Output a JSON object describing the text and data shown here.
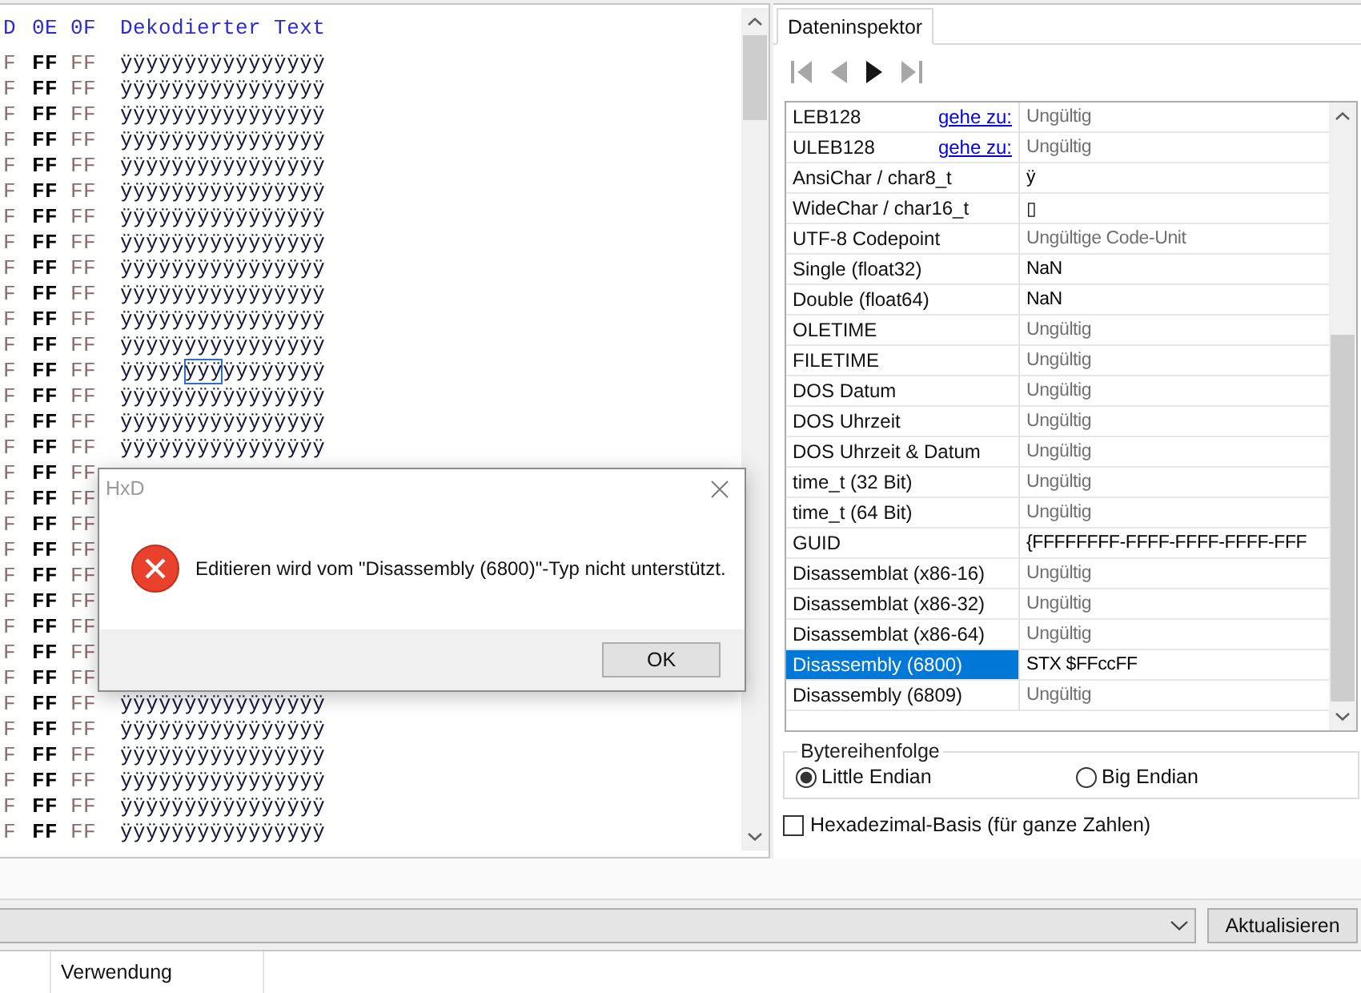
{
  "hex_view": {
    "column_headers": [
      "D",
      "0E",
      "0F"
    ],
    "text_header": "Dekodierter Text",
    "rows": [
      {
        "bytes": [
          "F",
          "FF",
          "FF"
        ],
        "text": "ÿÿÿÿÿÿÿÿÿÿÿÿÿÿÿÿ"
      },
      {
        "bytes": [
          "F",
          "FF",
          "FF"
        ],
        "text": "ÿÿÿÿÿÿÿÿÿÿÿÿÿÿÿÿ"
      },
      {
        "bytes": [
          "F",
          "FF",
          "FF"
        ],
        "text": "ÿÿÿÿÿÿÿÿÿÿÿÿÿÿÿÿ"
      },
      {
        "bytes": [
          "F",
          "FF",
          "FF"
        ],
        "text": "ÿÿÿÿÿÿÿÿÿÿÿÿÿÿÿÿ"
      },
      {
        "bytes": [
          "F",
          "FF",
          "FF"
        ],
        "text": "ÿÿÿÿÿÿÿÿÿÿÿÿÿÿÿÿ"
      },
      {
        "bytes": [
          "F",
          "FF",
          "FF"
        ],
        "text": "ÿÿÿÿÿÿÿÿÿÿÿÿÿÿÿÿ"
      },
      {
        "bytes": [
          "F",
          "FF",
          "FF"
        ],
        "text": "ÿÿÿÿÿÿÿÿÿÿÿÿÿÿÿÿ"
      },
      {
        "bytes": [
          "F",
          "FF",
          "FF"
        ],
        "text": "ÿÿÿÿÿÿÿÿÿÿÿÿÿÿÿÿ"
      },
      {
        "bytes": [
          "F",
          "FF",
          "FF"
        ],
        "text": "ÿÿÿÿÿÿÿÿÿÿÿÿÿÿÿÿ"
      },
      {
        "bytes": [
          "F",
          "FF",
          "FF"
        ],
        "text": "ÿÿÿÿÿÿÿÿÿÿÿÿÿÿÿÿ"
      },
      {
        "bytes": [
          "F",
          "FF",
          "FF"
        ],
        "text": "ÿÿÿÿÿÿÿÿÿÿÿÿÿÿÿÿ"
      },
      {
        "bytes": [
          "F",
          "FF",
          "FF"
        ],
        "text": "ÿÿÿÿÿÿÿÿÿÿÿÿÿÿÿÿ"
      },
      {
        "bytes": [
          "F",
          "FF",
          "FF"
        ],
        "segments": [
          {
            "text": "ÿÿÿÿÿ",
            "selected": false
          },
          {
            "text": "ÿÿÿ",
            "selected": true
          },
          {
            "text": "ÿÿÿÿÿÿÿÿ",
            "selected": false
          }
        ]
      },
      {
        "bytes": [
          "F",
          "FF",
          "FF"
        ],
        "text": "ÿÿÿÿÿÿÿÿÿÿÿÿÿÿÿÿ"
      },
      {
        "bytes": [
          "F",
          "FF",
          "FF"
        ],
        "text": "ÿÿÿÿÿÿÿÿÿÿÿÿÿÿÿÿ"
      },
      {
        "bytes": [
          "F",
          "FF",
          "FF"
        ],
        "text": "ÿÿÿÿÿÿÿÿÿÿÿÿÿÿÿÿ"
      },
      {
        "bytes": [
          "F",
          "FF",
          "FF"
        ]
      },
      {
        "bytes": [
          "F",
          "FF",
          "FF"
        ]
      },
      {
        "bytes": [
          "F",
          "FF",
          "FF"
        ]
      },
      {
        "bytes": [
          "F",
          "FF",
          "FF"
        ]
      },
      {
        "bytes": [
          "F",
          "FF",
          "FF"
        ]
      },
      {
        "bytes": [
          "F",
          "FF",
          "FF"
        ]
      },
      {
        "bytes": [
          "F",
          "FF",
          "FF"
        ]
      },
      {
        "bytes": [
          "F",
          "FF",
          "FF"
        ]
      },
      {
        "bytes": [
          "F",
          "FF",
          "FF"
        ]
      },
      {
        "bytes": [
          "F",
          "FF",
          "FF"
        ],
        "text": "ÿÿÿÿÿÿÿÿÿÿÿÿÿÿÿÿ"
      },
      {
        "bytes": [
          "F",
          "FF",
          "FF"
        ],
        "text": "ÿÿÿÿÿÿÿÿÿÿÿÿÿÿÿÿ"
      },
      {
        "bytes": [
          "F",
          "FF",
          "FF"
        ],
        "text": "ÿÿÿÿÿÿÿÿÿÿÿÿÿÿÿÿ"
      },
      {
        "bytes": [
          "F",
          "FF",
          "FF"
        ],
        "text": "ÿÿÿÿÿÿÿÿÿÿÿÿÿÿÿÿ"
      },
      {
        "bytes": [
          "F",
          "FF",
          "FF"
        ],
        "text": "ÿÿÿÿÿÿÿÿÿÿÿÿÿÿÿÿ"
      },
      {
        "bytes": [
          "F",
          "FF",
          "FF"
        ],
        "text": "ÿÿÿÿÿÿÿÿÿÿÿÿÿÿÿÿ"
      }
    ]
  },
  "inspector": {
    "tab": {
      "label": "Dateninspektor",
      "selected": true
    },
    "navigation": [
      {
        "kind": "first",
        "disabled": true
      },
      {
        "kind": "previous",
        "disabled": true
      },
      {
        "kind": "next",
        "disabled": false
      },
      {
        "kind": "last",
        "disabled": true
      }
    ],
    "rows": [
      {
        "label": "LEB128",
        "link": "gehe zu:",
        "value": "Ungültig",
        "valid": false,
        "selected": false
      },
      {
        "label": "ULEB128",
        "link": "gehe zu:",
        "value": "Ungültig",
        "valid": false,
        "selected": false
      },
      {
        "label": "AnsiChar / char8_t",
        "value": "ÿ",
        "valid": true,
        "selected": false
      },
      {
        "label": "WideChar / char16_t",
        "value": "▯",
        "valid": true,
        "selected": false
      },
      {
        "label": "UTF-8 Codepoint",
        "value": "Ungültige Code-Unit",
        "valid": false,
        "selected": false
      },
      {
        "label": "Single (float32)",
        "value": "NaN",
        "valid": true,
        "selected": false
      },
      {
        "label": "Double (float64)",
        "value": "NaN",
        "valid": true,
        "selected": false
      },
      {
        "label": "OLETIME",
        "value": "Ungültig",
        "valid": false,
        "selected": false
      },
      {
        "label": "FILETIME",
        "value": "Ungültig",
        "valid": false,
        "selected": false
      },
      {
        "label": "DOS Datum",
        "value": "Ungültig",
        "valid": false,
        "selected": false
      },
      {
        "label": "DOS Uhrzeit",
        "value": "Ungültig",
        "valid": false,
        "selected": false
      },
      {
        "label": "DOS Uhrzeit & Datum",
        "value": "Ungültig",
        "valid": false,
        "selected": false
      },
      {
        "label": "time_t (32 Bit)",
        "value": "Ungültig",
        "valid": false,
        "selected": false
      },
      {
        "label": "time_t (64 Bit)",
        "value": "Ungültig",
        "valid": false,
        "selected": false
      },
      {
        "label": "GUID",
        "value": "{FFFFFFFF-FFFF-FFFF-FFFF-FFF",
        "valid": true,
        "selected": false
      },
      {
        "label": "Disassemblat (x86-16)",
        "value": "Ungültig",
        "valid": false,
        "selected": false
      },
      {
        "label": "Disassemblat (x86-32)",
        "value": "Ungültig",
        "valid": false,
        "selected": false
      },
      {
        "label": "Disassemblat (x86-64)",
        "value": "Ungültig",
        "valid": false,
        "selected": false
      },
      {
        "label": "Disassembly (6800)",
        "value": "STX $FFccFF",
        "valid": true,
        "selected": true
      },
      {
        "label": "Disassembly (6809)",
        "value": "Ungültig",
        "valid": false,
        "selected": false
      }
    ],
    "byte_order": {
      "title": "Bytereihenfolge",
      "options": [
        {
          "label": "Little Endian",
          "selected": true
        },
        {
          "label": "Big Endian",
          "selected": false
        }
      ]
    },
    "hex_base": {
      "label": "Hexadezimal-Basis (für ganze Zahlen)",
      "checked": false
    }
  },
  "toolbar": {
    "button": "Aktualisieren"
  },
  "list_header": {
    "columns": [
      "Verwendung"
    ]
  },
  "dialog": {
    "title": "HxD",
    "kind": "error",
    "message": "Editieren wird vom \"Disassembly (6800)\"-Typ nicht unterstützt.",
    "button": "OK"
  }
}
